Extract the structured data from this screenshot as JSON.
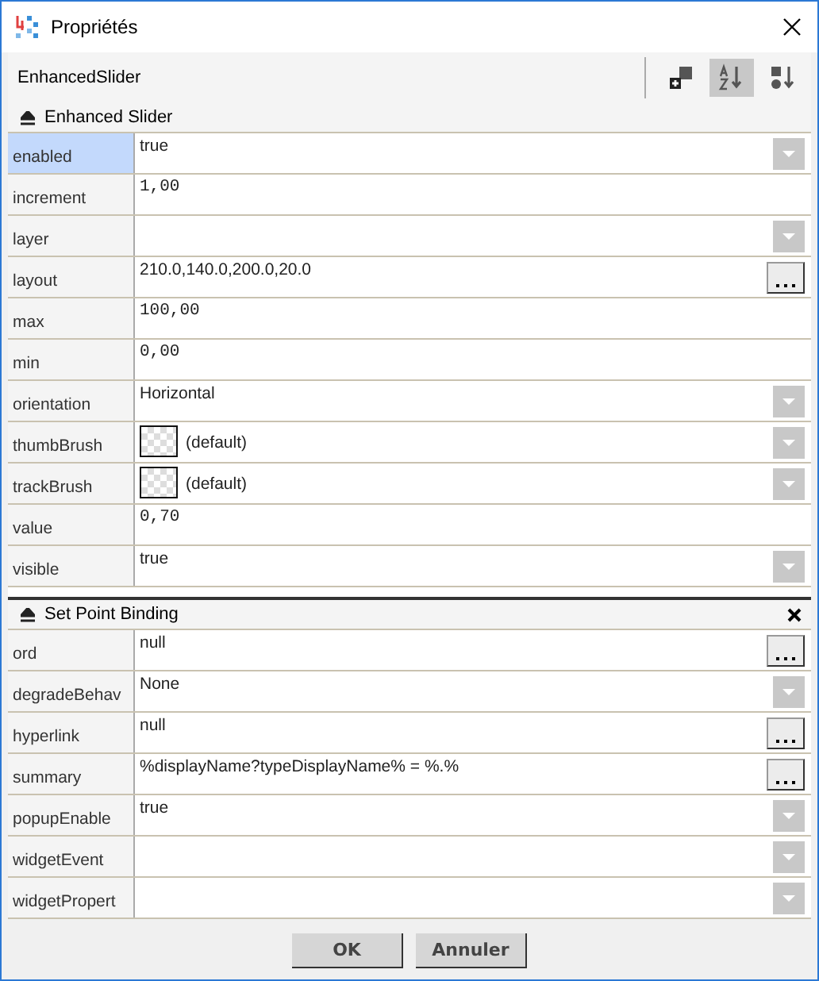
{
  "window": {
    "title": "Propriétés"
  },
  "toolbar": {
    "object_name": "EnhancedSlider",
    "buttons": [
      {
        "kind": "add",
        "selected": false
      },
      {
        "kind": "sort-alpha",
        "selected": true
      },
      {
        "kind": "sort-type",
        "selected": false
      }
    ]
  },
  "sections": [
    {
      "title": "Enhanced Slider",
      "expanded": true,
      "closable": false,
      "rows": [
        {
          "label": "enabled",
          "value": "true",
          "kind": "dropdown",
          "selected": true
        },
        {
          "label": "increment",
          "value": "1,00",
          "kind": "number",
          "selected": false
        },
        {
          "label": "layer",
          "value": "",
          "kind": "dropdown",
          "selected": false
        },
        {
          "label": "layout",
          "value": "210.0,140.0,200.0,20.0",
          "kind": "browse",
          "selected": false
        },
        {
          "label": "max",
          "value": "100,00",
          "kind": "number",
          "selected": false
        },
        {
          "label": "min",
          "value": "0,00",
          "kind": "number",
          "selected": false
        },
        {
          "label": "orientation",
          "value": "Horizontal",
          "kind": "dropdown",
          "selected": false
        },
        {
          "label": "thumbBrush",
          "value": "(default)",
          "kind": "brush",
          "selected": false
        },
        {
          "label": "trackBrush",
          "value": "(default)",
          "kind": "brush",
          "selected": false
        },
        {
          "label": "value",
          "value": "0,70",
          "kind": "number",
          "selected": false
        },
        {
          "label": "visible",
          "value": "true",
          "kind": "dropdown",
          "selected": false
        }
      ]
    },
    {
      "title": "Set Point Binding",
      "expanded": true,
      "closable": true,
      "rows": [
        {
          "label": "ord",
          "value": "null",
          "kind": "browse",
          "selected": false
        },
        {
          "label": "degradeBehav",
          "value": "None",
          "kind": "dropdown",
          "selected": false
        },
        {
          "label": "hyperlink",
          "value": "null",
          "kind": "browse",
          "selected": false
        },
        {
          "label": "summary",
          "value": "%displayName?typeDisplayName% = %.%",
          "kind": "browse",
          "selected": false
        },
        {
          "label": "popupEnable",
          "value": "true",
          "kind": "dropdown",
          "selected": false
        },
        {
          "label": "widgetEvent",
          "value": "",
          "kind": "dropdown",
          "selected": false
        },
        {
          "label": "widgetPropert",
          "value": "",
          "kind": "dropdown",
          "selected": false
        }
      ]
    }
  ],
  "buttons": [
    "OK",
    "Annuler"
  ]
}
